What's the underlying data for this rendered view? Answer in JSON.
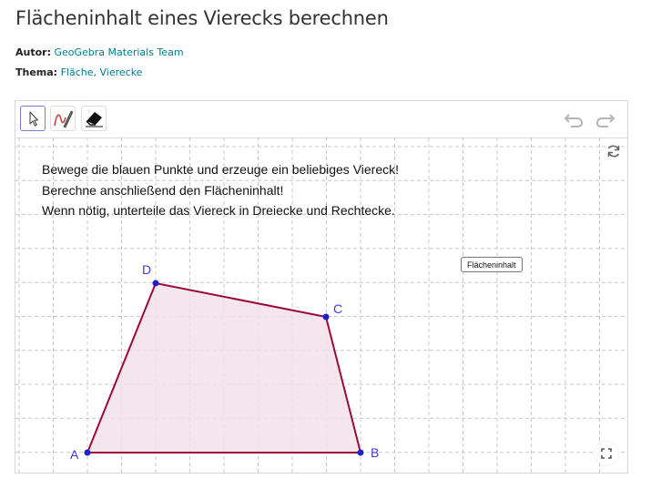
{
  "page": {
    "title": "Flächeninhalt eines Vierecks berechnen",
    "author_label": "Autor:",
    "author": "GeoGebra Materials Team",
    "topic_label": "Thema:",
    "topics": "Fläche, Vierecke"
  },
  "toolbar": {
    "tools": [
      "move-tool",
      "pen-tool",
      "eraser-tool"
    ],
    "undo_icon": "undo-icon",
    "redo_icon": "redo-icon"
  },
  "graphics": {
    "instructions": [
      "Bewege die blauen Punkte und erzeuge ein beliebiges Viereck!",
      "Berechne anschließend den Flächeninhalt!",
      "Wenn nötig, unterteile das Viereck in Dreiecke und Rechtecke."
    ],
    "area_button": "Flächeninhalt",
    "points": {
      "A": "A",
      "B": "B",
      "C": "C",
      "D": "D"
    },
    "colors": {
      "polygon_stroke": "#9b0a3a",
      "polygon_fill": "#f3e2ea",
      "point": "#2020c8",
      "grid": "#c8c8c8",
      "link": "#00798f"
    }
  }
}
